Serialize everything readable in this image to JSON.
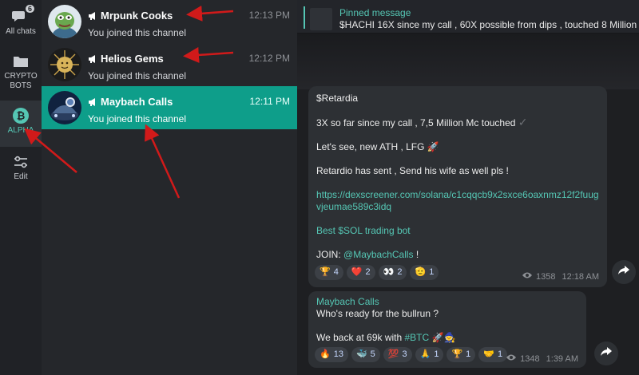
{
  "rail": {
    "items": [
      {
        "label": "All chats",
        "badge": "6"
      },
      {
        "label": "CRYPTO\nBOTS"
      },
      {
        "label": "ALPHA"
      },
      {
        "label": "Edit"
      }
    ]
  },
  "chats": [
    {
      "title": "Mrpunk Cooks",
      "time": "12:13 PM",
      "subtitle": "You joined this channel"
    },
    {
      "title": "Helios Gems",
      "time": "12:12 PM",
      "subtitle": "You joined this channel"
    },
    {
      "title": "Maybach Calls",
      "time": "12:11 PM",
      "subtitle": "You joined this channel"
    }
  ],
  "pinned": {
    "title": "Pinned message",
    "text": "$HACHI   16X since my call , 60X possible from dips , touched 8 Million  Mc"
  },
  "message1": {
    "lines": [
      "$Retardia",
      "3X   so far since my call , 7,5 Million Mc touched",
      "Let's see, new ATH , LFG 🚀",
      "Retardio has sent , Send his wife as well pls !",
      "https://dexscreener.com/solana/c1cqqcb9x2sxce6oaxnmz12f2fuug",
      "vjeumae589c3idq",
      "Best $SOL trading bot",
      "JOIN: ",
      "@MaybachCalls",
      " !"
    ],
    "check": "✓",
    "reactions": [
      {
        "emoji": "🏆",
        "count": "4"
      },
      {
        "emoji": "❤️",
        "count": "2"
      },
      {
        "emoji": "👀",
        "count": "2"
      },
      {
        "emoji": "🫡",
        "count": "1"
      }
    ],
    "views": "1358",
    "time": "12:18 AM"
  },
  "message2": {
    "sender": "Maybach Calls",
    "line1": "Who's ready for the bullrun ?",
    "line2_prefix": "We back at 69k with ",
    "line2_tag": "#BTC",
    "line2_suffix": " 🚀🧙",
    "reactions": [
      {
        "emoji": "🔥",
        "count": "13"
      },
      {
        "emoji": "🐳",
        "count": "5"
      },
      {
        "emoji": "💯",
        "count": "3"
      },
      {
        "emoji": "🙏",
        "count": "1"
      },
      {
        "emoji": "🏆",
        "count": "1"
      },
      {
        "emoji": "🤝",
        "count": "1"
      }
    ],
    "views": "1348",
    "time": "1:39 AM"
  },
  "icons": {
    "chat": "speech-bubbles-icon",
    "folder": "folder-icon",
    "bitcoin": "bitcoin-icon",
    "edit": "sliders-icon",
    "megaphone": "megaphone-icon",
    "eye": "eye-icon",
    "forward": "forward-arrow-icon"
  },
  "colors": {
    "accent": "#55c6b4",
    "active_row": "#0e9e8a",
    "annotation_arrow": "#d11a1a",
    "bubble": "#2d3034"
  }
}
